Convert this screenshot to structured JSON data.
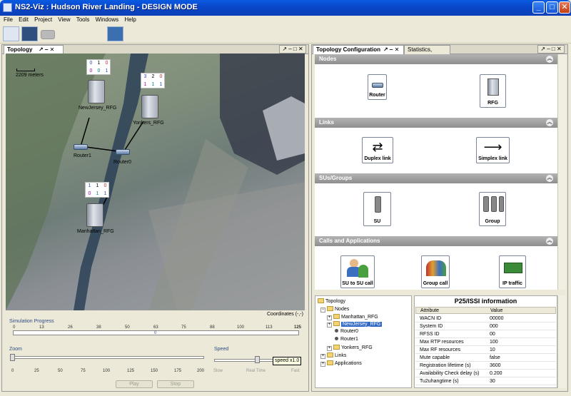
{
  "window": {
    "title": "NS2-Viz : Hudson River Landing - DESIGN MODE"
  },
  "menu": [
    "File",
    "Edit",
    "Project",
    "View",
    "Tools",
    "Windows",
    "Help"
  ],
  "left_panel": {
    "tab": "Topology",
    "tab_controls": "↗ ‒ ✕",
    "scale_label": "2209 meters",
    "nodes": {
      "newjersey": {
        "label": "NewJersey_RFG",
        "counters": [
          "0",
          "1",
          "0",
          "0",
          "0",
          "1"
        ]
      },
      "yonkers": {
        "label": "Yonkers_RFG",
        "counters": [
          "3",
          "2",
          "0",
          "1",
          "1",
          "1"
        ]
      },
      "manhattan": {
        "label": "Manhattan_RFG",
        "counters": [
          "1",
          "1",
          "0",
          "0",
          "1",
          "1"
        ]
      },
      "router1": {
        "label": "Router1"
      },
      "router0": {
        "label": "Router0"
      }
    },
    "coordinates": "Coordinates (-,-)",
    "sim_progress": {
      "label": "Simulation Progress",
      "ticks": [
        "0",
        "13",
        "26",
        "38",
        "50",
        "63",
        "75",
        "88",
        "100",
        "113",
        "125"
      ],
      "value_label": "0"
    },
    "zoom": {
      "label": "Zoom",
      "ticks": [
        "0",
        "25",
        "50",
        "75",
        "100",
        "125",
        "150",
        "175",
        "200"
      ]
    },
    "speed": {
      "label": "Speed",
      "ticks": [
        "Slow",
        "Real Time",
        "Fast"
      ],
      "tooltip": "speed x1.0"
    },
    "play_button": "Play",
    "stop_button": "Stop"
  },
  "right_panel": {
    "tabs": [
      "Topology Configuration",
      "Statistics, Media"
    ],
    "sections": {
      "nodes": {
        "title": "Nodes",
        "items": [
          "Router",
          "RFG"
        ]
      },
      "links": {
        "title": "Links",
        "items": [
          "Duplex link",
          "Simplex link"
        ]
      },
      "groups": {
        "title": "SUs/Groups",
        "items": [
          "SU",
          "Group"
        ]
      },
      "calls": {
        "title": "Calls and Applications",
        "items": [
          "SU to SU call",
          "Group call",
          "IP traffic"
        ]
      }
    },
    "tree": {
      "root": "Topology",
      "nodes": "Nodes",
      "children": [
        "Manhattan_RFG",
        "NewJersey_RFG",
        "Router0",
        "Router1",
        "Yonkers_RFG"
      ],
      "links": "Links",
      "applications": "Applications"
    },
    "info": {
      "title": "P25/ISSI information",
      "header": [
        "Attribute",
        "Value"
      ],
      "rows": [
        [
          "WACN ID",
          "00000"
        ],
        [
          "System ID",
          "000"
        ],
        [
          "RFSS ID",
          "00"
        ],
        [
          "Max RTP resources",
          "100"
        ],
        [
          "Max RF resources",
          "10"
        ],
        [
          "Mute capable",
          "false"
        ],
        [
          "Registration lifetime (s)",
          "3600"
        ],
        [
          "Availability Check delay (s)",
          "0.200"
        ],
        [
          "Tu2uhangtime (s)",
          "30"
        ]
      ]
    }
  },
  "colors": {
    "titlebar": "#0a4fd6",
    "selection": "#316ac5",
    "section_header": "#a0a0a0"
  }
}
